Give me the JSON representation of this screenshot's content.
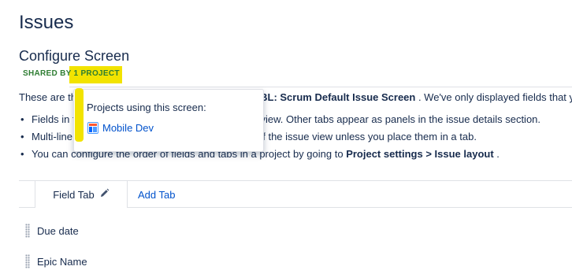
{
  "header": {
    "title": "Issues",
    "subtitle": "Configure Screen"
  },
  "shared": {
    "prefix": "SHARED BY",
    "count": "1 PROJECT"
  },
  "description": {
    "lead": "These are th",
    "screen_name": "OBL: Scrum Default Issue Screen",
    "tail": " . We've only displayed fields that y"
  },
  "bullets": [
    {
      "part1": "Fields in t",
      "part2": "e view. Other tabs appear as panels in the issue details section."
    },
    {
      "part1": "Multi-line",
      "part2": "of the issue view unless you place them in a tab."
    },
    {
      "pre": "You can configure the order of fields and tabs in a project by going to ",
      "bold1": "Project settings",
      "mid": " > ",
      "bold2": "Issue layout",
      "post": " ."
    }
  ],
  "popover": {
    "title": "Projects using this screen:",
    "projects": [
      {
        "name": "Mobile Dev",
        "icon": "project-avatar-icon"
      }
    ]
  },
  "tabs": {
    "active_label": "Field Tab",
    "edit_icon": "pencil-icon",
    "add_label": "Add Tab"
  },
  "fields": [
    {
      "label": "Due date"
    },
    {
      "label": "Epic Name"
    }
  ],
  "colors": {
    "highlight": "#f2e300",
    "link": "#0052cc",
    "text": "#172b4d",
    "shared_green": "#2e7d32"
  }
}
